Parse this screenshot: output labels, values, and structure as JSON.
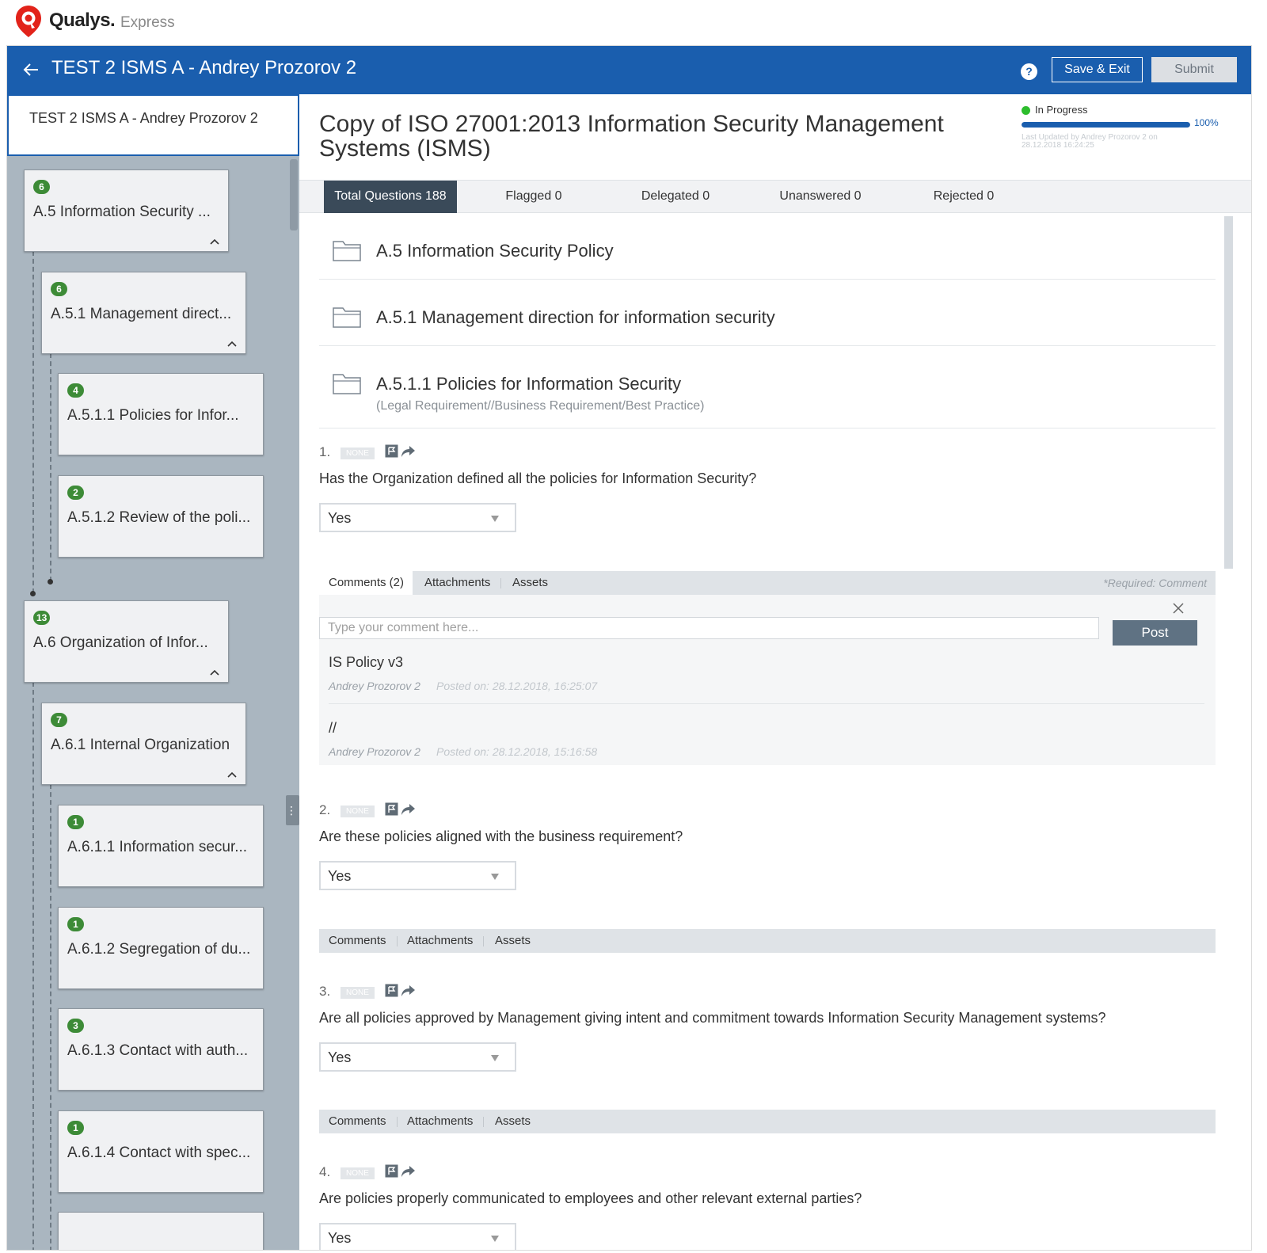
{
  "brand": {
    "name": "Qualys.",
    "product": "Express"
  },
  "topbar": {
    "title": "TEST 2 ISMS A - Andrey Prozorov 2",
    "help_label": "?",
    "save_label": "Save & Exit",
    "submit_label": "Submit"
  },
  "sidebar": {
    "header": "TEST 2 ISMS A - Andrey Prozorov 2",
    "items": [
      {
        "count": "6",
        "label": "A.5 Information Security ..."
      },
      {
        "count": "6",
        "label": "A.5.1 Management direct..."
      },
      {
        "count": "4",
        "label": "A.5.1.1 Policies for Infor..."
      },
      {
        "count": "2",
        "label": "A.5.1.2 Review of the poli..."
      },
      {
        "count": "13",
        "label": "A.6 Organization of Infor..."
      },
      {
        "count": "7",
        "label": "A.6.1 Internal Organization"
      },
      {
        "count": "1",
        "label": "A.6.1.1 Information secur..."
      },
      {
        "count": "1",
        "label": "A.6.1.2 Segregation of du..."
      },
      {
        "count": "3",
        "label": "A.6.1.3 Contact with auth..."
      },
      {
        "count": "1",
        "label": "A.6.1.4 Contact with spec..."
      }
    ]
  },
  "main": {
    "title": "Copy of ISO 27001:2013 Information Security Management Systems (ISMS)",
    "status": {
      "label": "In Progress",
      "progress": 100,
      "progress_label": "100%",
      "updated": "Last Updated by Andrey Prozorov 2 on 28.12.2018 16:24:25"
    },
    "tabs": [
      {
        "label": "Total Questions 188"
      },
      {
        "label": "Flagged 0"
      },
      {
        "label": "Delegated 0"
      },
      {
        "label": "Unanswered 0"
      },
      {
        "label": "Rejected 0"
      }
    ],
    "sections": [
      {
        "title": "A.5 Information Security Policy"
      },
      {
        "title": "A.5.1 Management direction for information security"
      },
      {
        "title": "A.5.1.1 Policies for Information Security",
        "subtitle": "(Legal Requirement//Business Requirement/Best Practice)"
      }
    ],
    "questions": [
      {
        "number": "1.",
        "tag": "NONE",
        "text": "Has the Organization defined all the policies for Information Security?",
        "answer": "Yes",
        "tabs": {
          "comments": "Comments (2)",
          "attachments": "Attachments",
          "assets": "Assets"
        },
        "required": "*Required: Comment",
        "comment_placeholder": "Type your comment here...",
        "post_label": "Post",
        "comments": [
          {
            "text": "IS Policy v3",
            "author": "Andrey Prozorov 2",
            "posted": "Posted on: 28.12.2018, 16:25:07"
          },
          {
            "text": "//",
            "author": "Andrey Prozorov 2",
            "posted": "Posted on: 28.12.2018, 15:16:58"
          }
        ]
      },
      {
        "number": "2.",
        "tag": "NONE",
        "text": "Are these policies aligned with the business requirement?",
        "answer": "Yes",
        "tabs": {
          "comments": "Comments",
          "attachments": "Attachments",
          "assets": "Assets"
        }
      },
      {
        "number": "3.",
        "tag": "NONE",
        "text": "Are all policies approved by Management giving intent and commitment towards Information Security Management systems?",
        "answer": "Yes",
        "tabs": {
          "comments": "Comments",
          "attachments": "Attachments",
          "assets": "Assets"
        }
      },
      {
        "number": "4.",
        "tag": "NONE",
        "text": "Are policies properly communicated to employees and other relevant external parties?",
        "answer": "Yes"
      }
    ]
  },
  "colors": {
    "brand_blue": "#1a5eae",
    "qualys_red": "#e2231a",
    "badge_green": "#3d8b37",
    "status_green": "#2dbd2d",
    "active_tab": "#3a4a59",
    "sidebar_bg": "#aab6c0"
  },
  "icons": [
    "qualys-logo-icon",
    "back-arrow-icon",
    "help-icon",
    "chevron-up-icon",
    "folder-icon",
    "flag-icon",
    "share-icon",
    "close-icon",
    "resize-handle-icon"
  ]
}
